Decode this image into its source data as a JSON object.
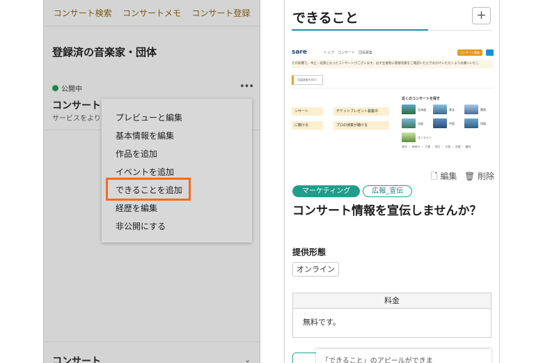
{
  "left": {
    "nav": [
      "コンサート検索",
      "コンサートメモ",
      "コンサート登録"
    ],
    "section_title": "登録済の音楽家・団体",
    "status": "公開中",
    "item_title": "コンサート",
    "item_sub": "サービスをより",
    "menu": [
      "プレビューと編集",
      "基本情報を編集",
      "作品を追加",
      "イベントを追加",
      "できることを追加",
      "経歴を編集",
      "非公開にする"
    ],
    "highlighted_item": "できることを追加",
    "bottom_title": "コンサート",
    "highlight_color": "#f06b21"
  },
  "right": {
    "title": "できること",
    "plus": "+",
    "preview": {
      "logo": "sare",
      "nav": "トップ　コンサート　団員募集",
      "notice": "えの影響で、中止・延期となったコンサートがございます。必ず主催者に開催有無をご確認いただきおかけいただくようお願いいたし",
      "search": "団員募集を探す",
      "chips": [
        "ンサート",
        "チケットプレゼント募集中",
        "に動ける",
        "プロの演奏が聴ける"
      ],
      "near_title": "近くのコンサートを探す",
      "regions": [
        "北海道",
        "東北",
        "関東",
        "北陸",
        "中国",
        "四国",
        "オンライン"
      ],
      "prefs": "東京 ｜ 神奈川 ｜ 千葉 ｜ 埼玉 ｜ 大阪 ｜ 京都 ｜ 福岡"
    },
    "edit": "編集",
    "delete": "削除",
    "tags": [
      "マーケティング",
      "広報_宣伝"
    ],
    "feature_title": "コンサート情報を宣伝しませんか？",
    "form_label": "提供形態",
    "form_value": "オンライン",
    "fee_label": "料金",
    "fee_value": "無料です。",
    "tooltip": "「できること」のアピールができま",
    "accent": "#1f9e8a"
  }
}
